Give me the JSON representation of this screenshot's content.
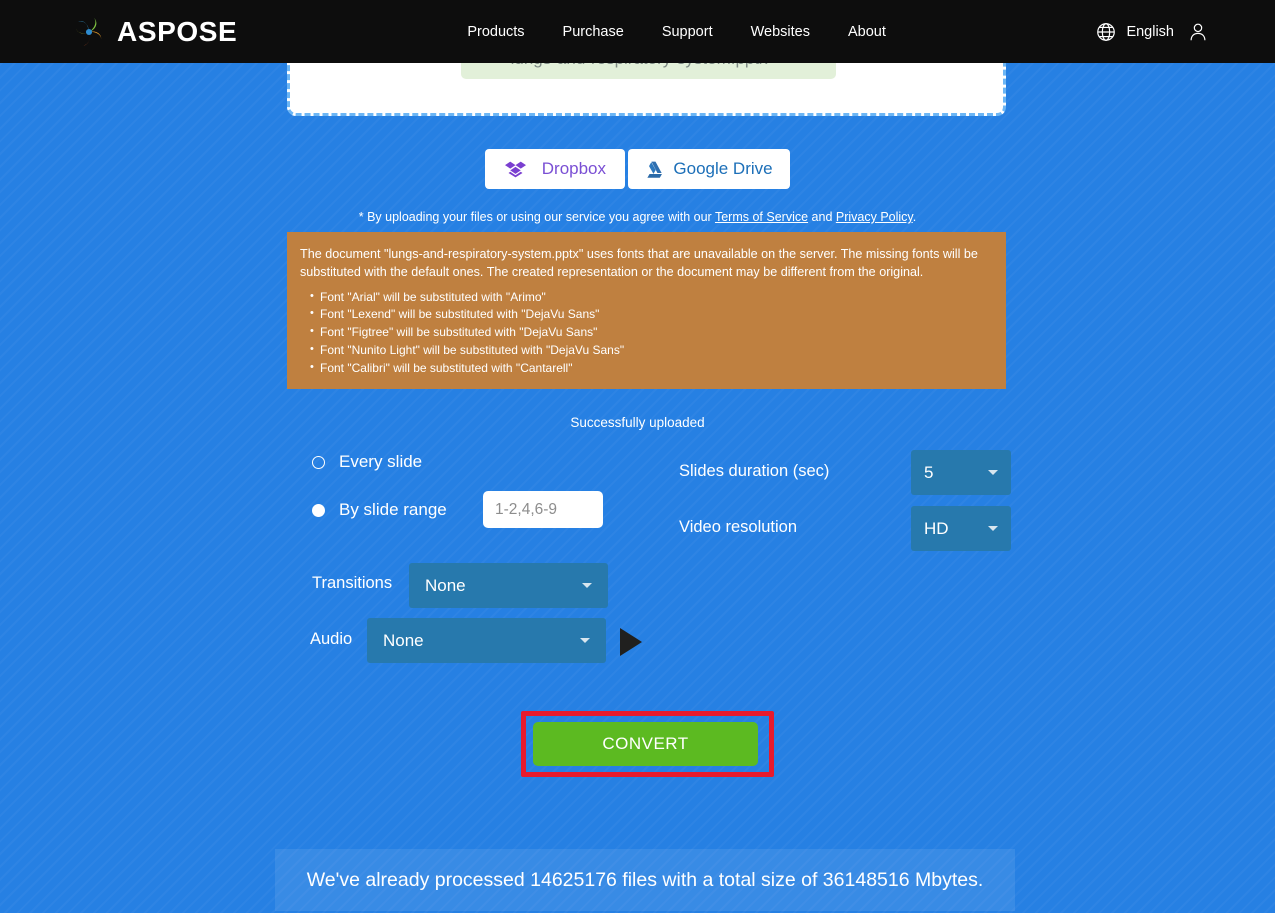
{
  "header": {
    "brand": "ASPOSE",
    "brand_icon": "aspose-spiral-logo",
    "nav": [
      {
        "label": "Products"
      },
      {
        "label": "Purchase"
      },
      {
        "label": "Support"
      },
      {
        "label": "Websites"
      },
      {
        "label": "About"
      }
    ],
    "language": "English",
    "language_icon": "globe-icon",
    "account_icon": "user-icon"
  },
  "dropzone": {
    "file_name": "lungs-and-respiratory-system.pptx",
    "remove_glyph": "×"
  },
  "cloud": {
    "dropbox_label": "Dropbox",
    "dropbox_icon": "dropbox-icon",
    "gdrive_label": "Google Drive",
    "gdrive_icon": "google-drive-icon"
  },
  "terms": {
    "prefix": "* By uploading your files or using our service you agree with our ",
    "tos_label": "Terms of Service",
    "middle": " and ",
    "privacy_label": "Privacy Policy",
    "suffix": "."
  },
  "warning": {
    "headline": "The document \"lungs-and-respiratory-system.pptx\" uses fonts that are unavailable on the server. The missing fonts will be substituted with the default ones. The created representation or the document may be different from the original.",
    "items": [
      {
        "text": "Font \"Arial\" will be substituted with \"Arimo\""
      },
      {
        "text": "Font \"Lexend\" will be substituted with \"DejaVu Sans\""
      },
      {
        "text": "Font \"Figtree\" will be substituted with \"DejaVu Sans\""
      },
      {
        "text": "Font \"Nunito Light\" will be substituted with \"DejaVu Sans\""
      },
      {
        "text": "Font \"Calibri\" will be substituted with \"Cantarell\""
      }
    ],
    "background_color": "#bf8040"
  },
  "status": {
    "upload_message": "Successfully uploaded"
  },
  "options": {
    "every_slide_label": "Every slide",
    "every_slide_selected": false,
    "by_range_label": "By slide range",
    "by_range_selected": true,
    "range_placeholder": "1-2,4,6-9",
    "range_value": "",
    "slides_duration_label": "Slides duration (sec)",
    "slides_duration_value": "5",
    "video_resolution_label": "Video resolution",
    "video_resolution_value": "HD",
    "transitions_label": "Transitions",
    "transitions_value": "None",
    "audio_label": "Audio",
    "audio_value": "None",
    "play_icon": "play-icon"
  },
  "convert": {
    "label": "CONVERT",
    "button_color": "#5cba21",
    "highlight_color": "#e81a2d"
  },
  "stats": {
    "text": "We've already processed 14625176 files with a total size of 36148516 Mbytes."
  },
  "theme": {
    "page_background": "#2680e3",
    "header_background": "#0d0d0d",
    "select_background": "#2779ad"
  }
}
